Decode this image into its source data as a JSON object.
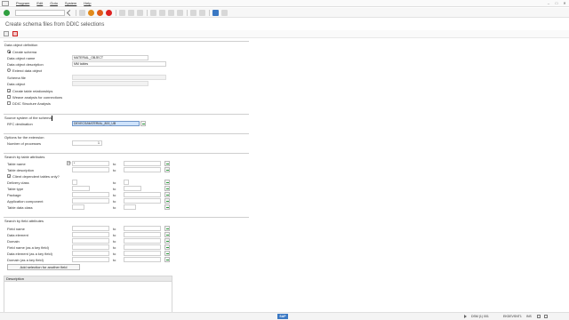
{
  "menu": {
    "items": [
      "Program",
      "Edit",
      "Goto",
      "System",
      "Help"
    ]
  },
  "title": "Create schema files from DDIC selections",
  "groups": {
    "data_object_definition": {
      "title": "Data object definition",
      "create_schema": "Create schema",
      "data_object_name_label": "Data object name",
      "data_object_name_value": "MATERIAL_OBJECT",
      "data_object_description_label": "Data object description",
      "data_object_description_value": "MM tables",
      "extend_data_object": "Extend data object",
      "schema_file_label": "Schema file",
      "data_object_label": "Data object",
      "create_table_relationships": "Create table relationships",
      "weave_analysis_for_connections": "Weave analysis for connections",
      "ddic_structure_analysis": "DDIC Structure Analysis"
    },
    "source_system": {
      "title": "Source system of the schema",
      "rfc_destination_label": "RFC destination",
      "rfc_destination_value": "DEVECS/MATERIAL_800_UB"
    },
    "options_extension": {
      "title": "Options for the extension",
      "number_of_processes_label": "Number of processes",
      "number_of_processes_value": "1"
    },
    "search_table": {
      "title": "Search by table attributes",
      "to_label": "to",
      "table_name_label": "Table name",
      "table_name_op": "[=]",
      "table_name_value": "*",
      "table_description_label": "Table description",
      "client_dependent_label": "Client dependent tables only?",
      "delivery_class_label": "Delivery class",
      "table_type_label": "Table type",
      "package_label": "Package",
      "application_component_label": "Application component",
      "table_data_class_label": "Table data class"
    },
    "search_field": {
      "title": "Search by field attributes",
      "field_name_label": "Field name",
      "data_element_label": "Data element",
      "domain_label": "Domain",
      "field_name_key_label": "Field name (as a key field)",
      "data_element_key_label": "Data element (as a key field)",
      "domain_key_label": "Domain (as a key field)",
      "add_selection_button": "Add selection for another field"
    },
    "description_table": {
      "header": "Description"
    }
  },
  "status": {
    "logo": "SAP",
    "system": "DSM (1) 001",
    "server": "EKDEVSNT1",
    "mode": "INS"
  },
  "icons": {
    "ok": "green-check-icon",
    "back": "back-icon",
    "exit": "exit-icon",
    "cancel": "cancel-icon"
  }
}
